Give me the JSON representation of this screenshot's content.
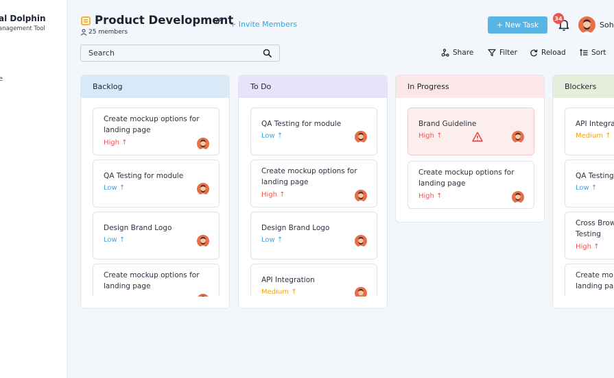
{
  "sidebar": {
    "brand_name": "al Dolphin",
    "brand_sub": "anagement Tool",
    "item_fragment": "e"
  },
  "header": {
    "title": "Product Development",
    "invite_label": "+ Invite Members",
    "members": "25 members",
    "new_task_label": "+ New Task",
    "notification_count": "34",
    "user_name": "Soh"
  },
  "search": {
    "placeholder": "Search"
  },
  "toolbar": {
    "share": "Share",
    "filter": "Filter",
    "reload": "Reload",
    "sort": "Sort"
  },
  "colors": {
    "accent": "#5ab5e7",
    "high": "#ef5350",
    "low": "#42a5e6",
    "medium": "#f2a516",
    "backlog_header": "#d8eaf8",
    "todo_header": "#e8e3f8",
    "inprogress_header": "#fbe7e7",
    "blockers_header": "#e6efdc"
  },
  "columns": [
    {
      "title": "Backlog",
      "cards": [
        {
          "title": "Create mockup options for landing page",
          "priority": "High",
          "priority_icon": "arrow-up-icon"
        },
        {
          "title": "QA Testing for module",
          "priority": "Low",
          "priority_icon": "arrow-up-icon"
        },
        {
          "title": "Design Brand Logo",
          "priority": "Low",
          "priority_icon": "arrow-up-icon"
        },
        {
          "title": "Create mockup options for landing page",
          "priority": "",
          "priority_icon": ""
        }
      ]
    },
    {
      "title": "To Do",
      "cards": [
        {
          "title": "QA Testing for module",
          "priority": "Low",
          "priority_icon": "arrow-up-icon"
        },
        {
          "title": "Create mockup options for landing page",
          "priority": "High",
          "priority_icon": "arrow-up-icon"
        },
        {
          "title": "Design Brand Logo",
          "priority": "Low",
          "priority_icon": "arrow-up-icon"
        },
        {
          "title": "API Integration",
          "priority": "Medium",
          "priority_icon": "arrow-up-icon"
        }
      ]
    },
    {
      "title": "In Progress",
      "cards": [
        {
          "title": "Brand Guideline",
          "priority": "High",
          "priority_icon": "arrow-up-icon",
          "status_icon": "warning-icon"
        },
        {
          "title": "Create mockup options for landing page",
          "priority": "High",
          "priority_icon": "arrow-up-icon"
        }
      ]
    },
    {
      "title": "Blockers",
      "cards": [
        {
          "title": "API Integra",
          "priority": "Medium",
          "priority_icon": "arrow-up-icon"
        },
        {
          "title": "QA Testing",
          "priority": "Low",
          "priority_icon": "arrow-up-icon"
        },
        {
          "title": "Cross Brow Testing",
          "priority": "High",
          "priority_icon": "arrow-up-icon"
        },
        {
          "title": "Create mo landing pa",
          "priority": "",
          "priority_icon": ""
        }
      ]
    }
  ]
}
